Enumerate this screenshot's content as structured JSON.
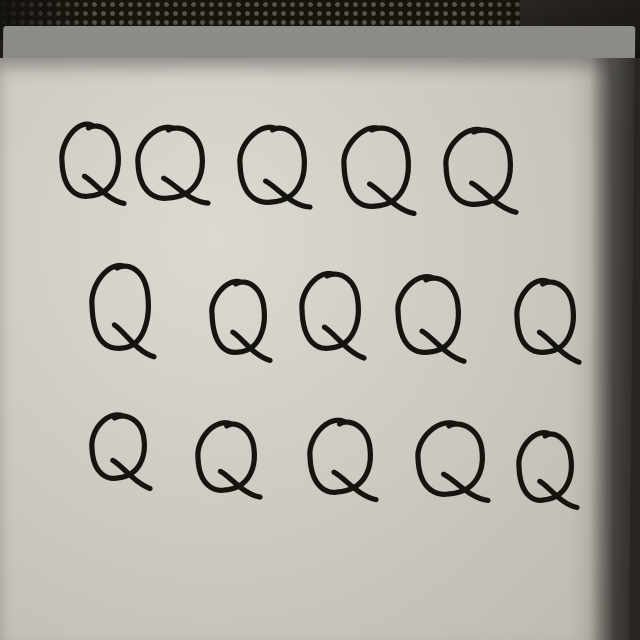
{
  "scene": {
    "subject": "whiteboard",
    "colors": {
      "background": "#1d1b17",
      "board_surface": "#d2cec7",
      "frame": "#7c7b75",
      "marker_ink": "#15140f"
    }
  },
  "handwriting": {
    "character": "Q",
    "rows": [
      {
        "letters": [
          "Q",
          "Q",
          "Q",
          "Q",
          "Q"
        ]
      },
      {
        "letters": [
          "Q",
          "Q",
          "Q",
          "Q",
          "Q"
        ]
      },
      {
        "letters": [
          "Q",
          "Q",
          "Q",
          "Q",
          "Q"
        ]
      }
    ]
  }
}
